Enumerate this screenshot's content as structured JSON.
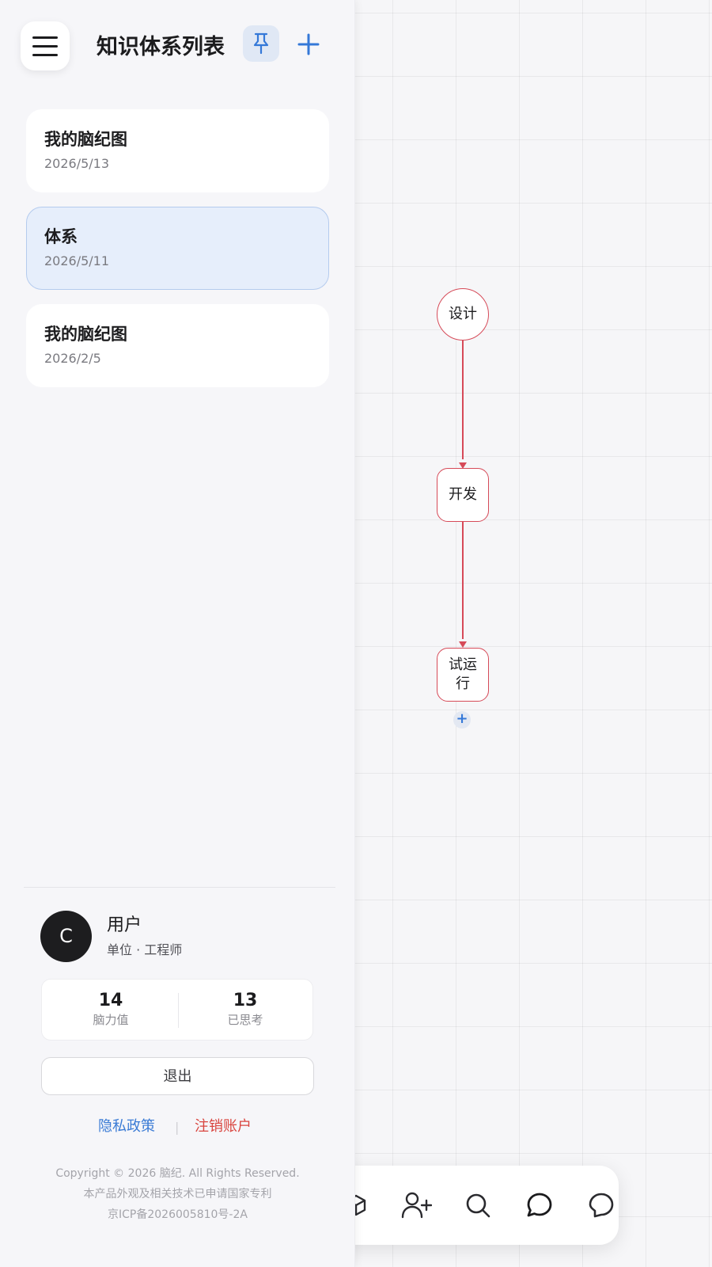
{
  "sidebar": {
    "title": "知识体系列表",
    "menu_icon": "hamburger-menu-icon",
    "pin_icon": "pin-icon",
    "add_icon": "plus-icon",
    "items": [
      {
        "title": "我的脑纪图",
        "date": "2026/5/13",
        "active": false
      },
      {
        "title": "体系",
        "date": "2026/5/11",
        "active": true
      },
      {
        "title": "我的脑纪图",
        "date": "2026/2/5",
        "active": false
      }
    ]
  },
  "user": {
    "avatar_letter": "C",
    "name": "用户",
    "meta": "单位 · 工程师",
    "stats": [
      {
        "value": "14",
        "label": "脑力值"
      },
      {
        "value": "13",
        "label": "已思考"
      }
    ],
    "logout_label": "退出",
    "privacy_link": "隐私政策",
    "link_separator": "|",
    "cancel_account_link": "注销账户"
  },
  "footer": {
    "copyright": "Copyright © 2026 脑纪. All Rights Reserved.",
    "patent": "本产品外观及相关技术已申请国家专利",
    "icp": "京ICP备2026005810号-2A"
  },
  "mindmap": {
    "nodes": [
      "设计",
      "开发",
      "试运\n行"
    ],
    "add_symbol": "+"
  },
  "toolbar": {
    "icons": [
      "cube-icon",
      "add-user-icon",
      "search-icon",
      "chat-icon",
      "feedback-icon"
    ]
  },
  "colors": {
    "accent": "#3478d8",
    "node_border": "#d64a58",
    "danger": "#d9453f",
    "active_item_bg": "#e6eefb"
  }
}
